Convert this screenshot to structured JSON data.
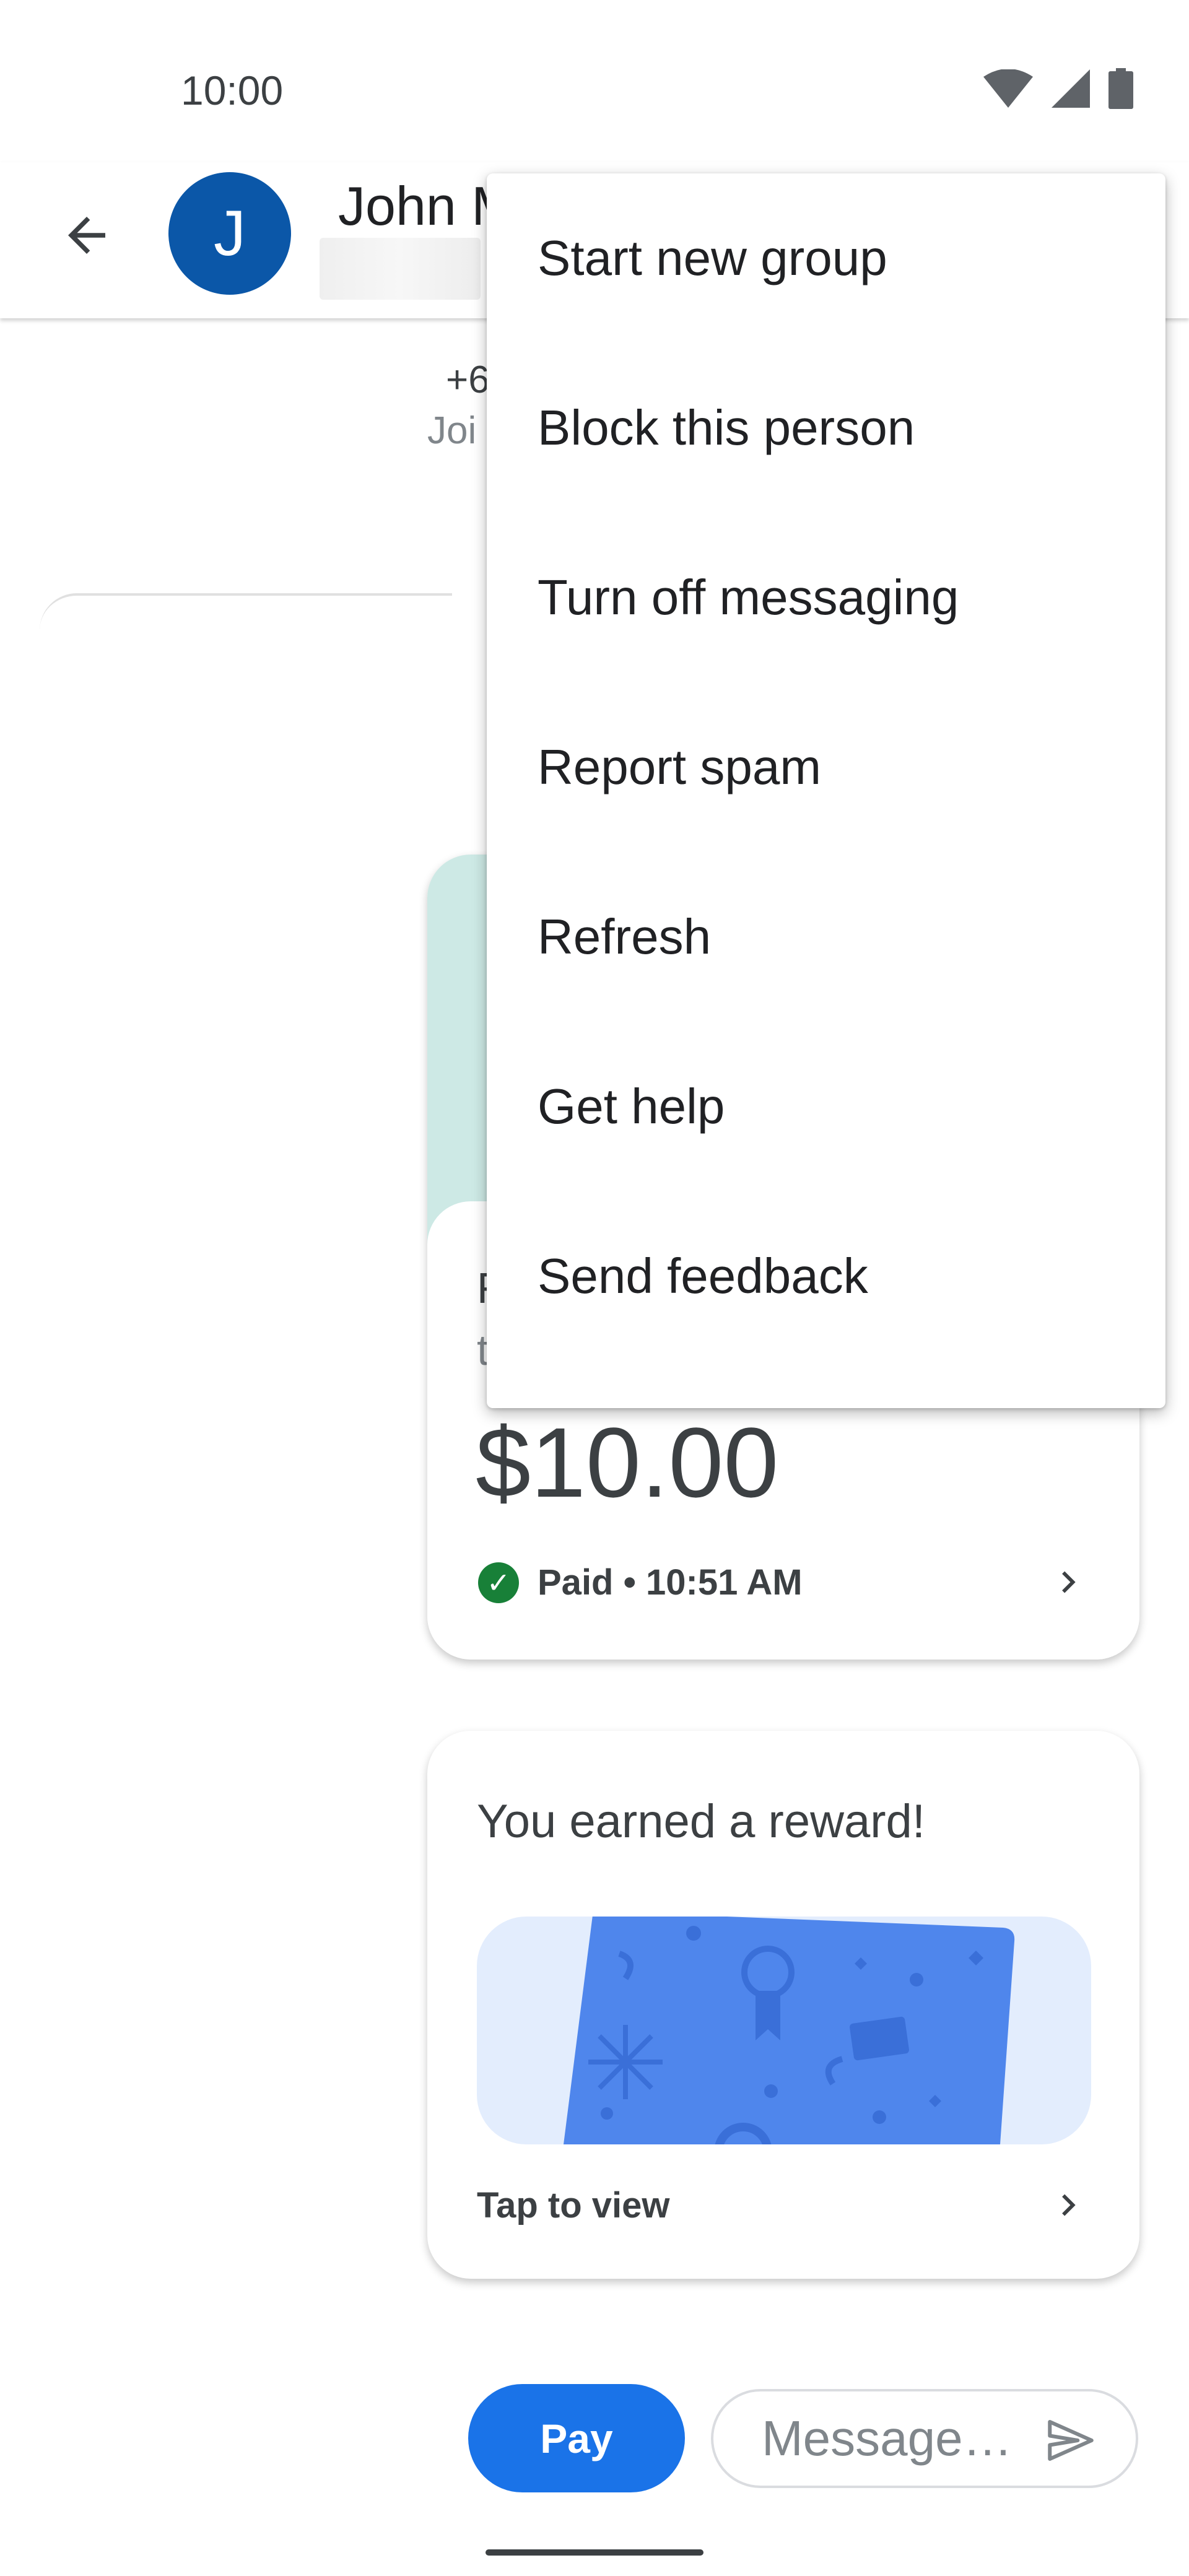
{
  "status_bar": {
    "time": "10:00"
  },
  "header": {
    "avatar_initial": "J",
    "contact_name_partial": "John M",
    "phone_partial": "+6",
    "joined_partial": "Joi"
  },
  "payment_card": {
    "title_partial": "F",
    "subtitle_partial": "t",
    "amount": "$10.00",
    "status": "Paid • 10:51 AM"
  },
  "reward_card": {
    "title": "You earned a reward!",
    "action": "Tap to view"
  },
  "compose": {
    "pay_label": "Pay",
    "message_placeholder": "Message…"
  },
  "menu": {
    "items": [
      {
        "label": "Start new group"
      },
      {
        "label": "Block this person"
      },
      {
        "label": "Turn off messaging"
      },
      {
        "label": "Report spam"
      },
      {
        "label": "Refresh"
      },
      {
        "label": "Get help"
      },
      {
        "label": "Send feedback"
      }
    ]
  },
  "colors": {
    "avatar": "#0b57a8",
    "pay_button": "#1a73e8",
    "paid_check": "#188038",
    "card_header": "#cde9e5",
    "reward_banner": "#e3edfd",
    "reward_card_art": "#4f86ec"
  },
  "icons": [
    "wifi-icon",
    "signal-icon",
    "battery-icon",
    "back-arrow-icon",
    "check-circle-icon",
    "chevron-right-icon",
    "send-icon"
  ]
}
